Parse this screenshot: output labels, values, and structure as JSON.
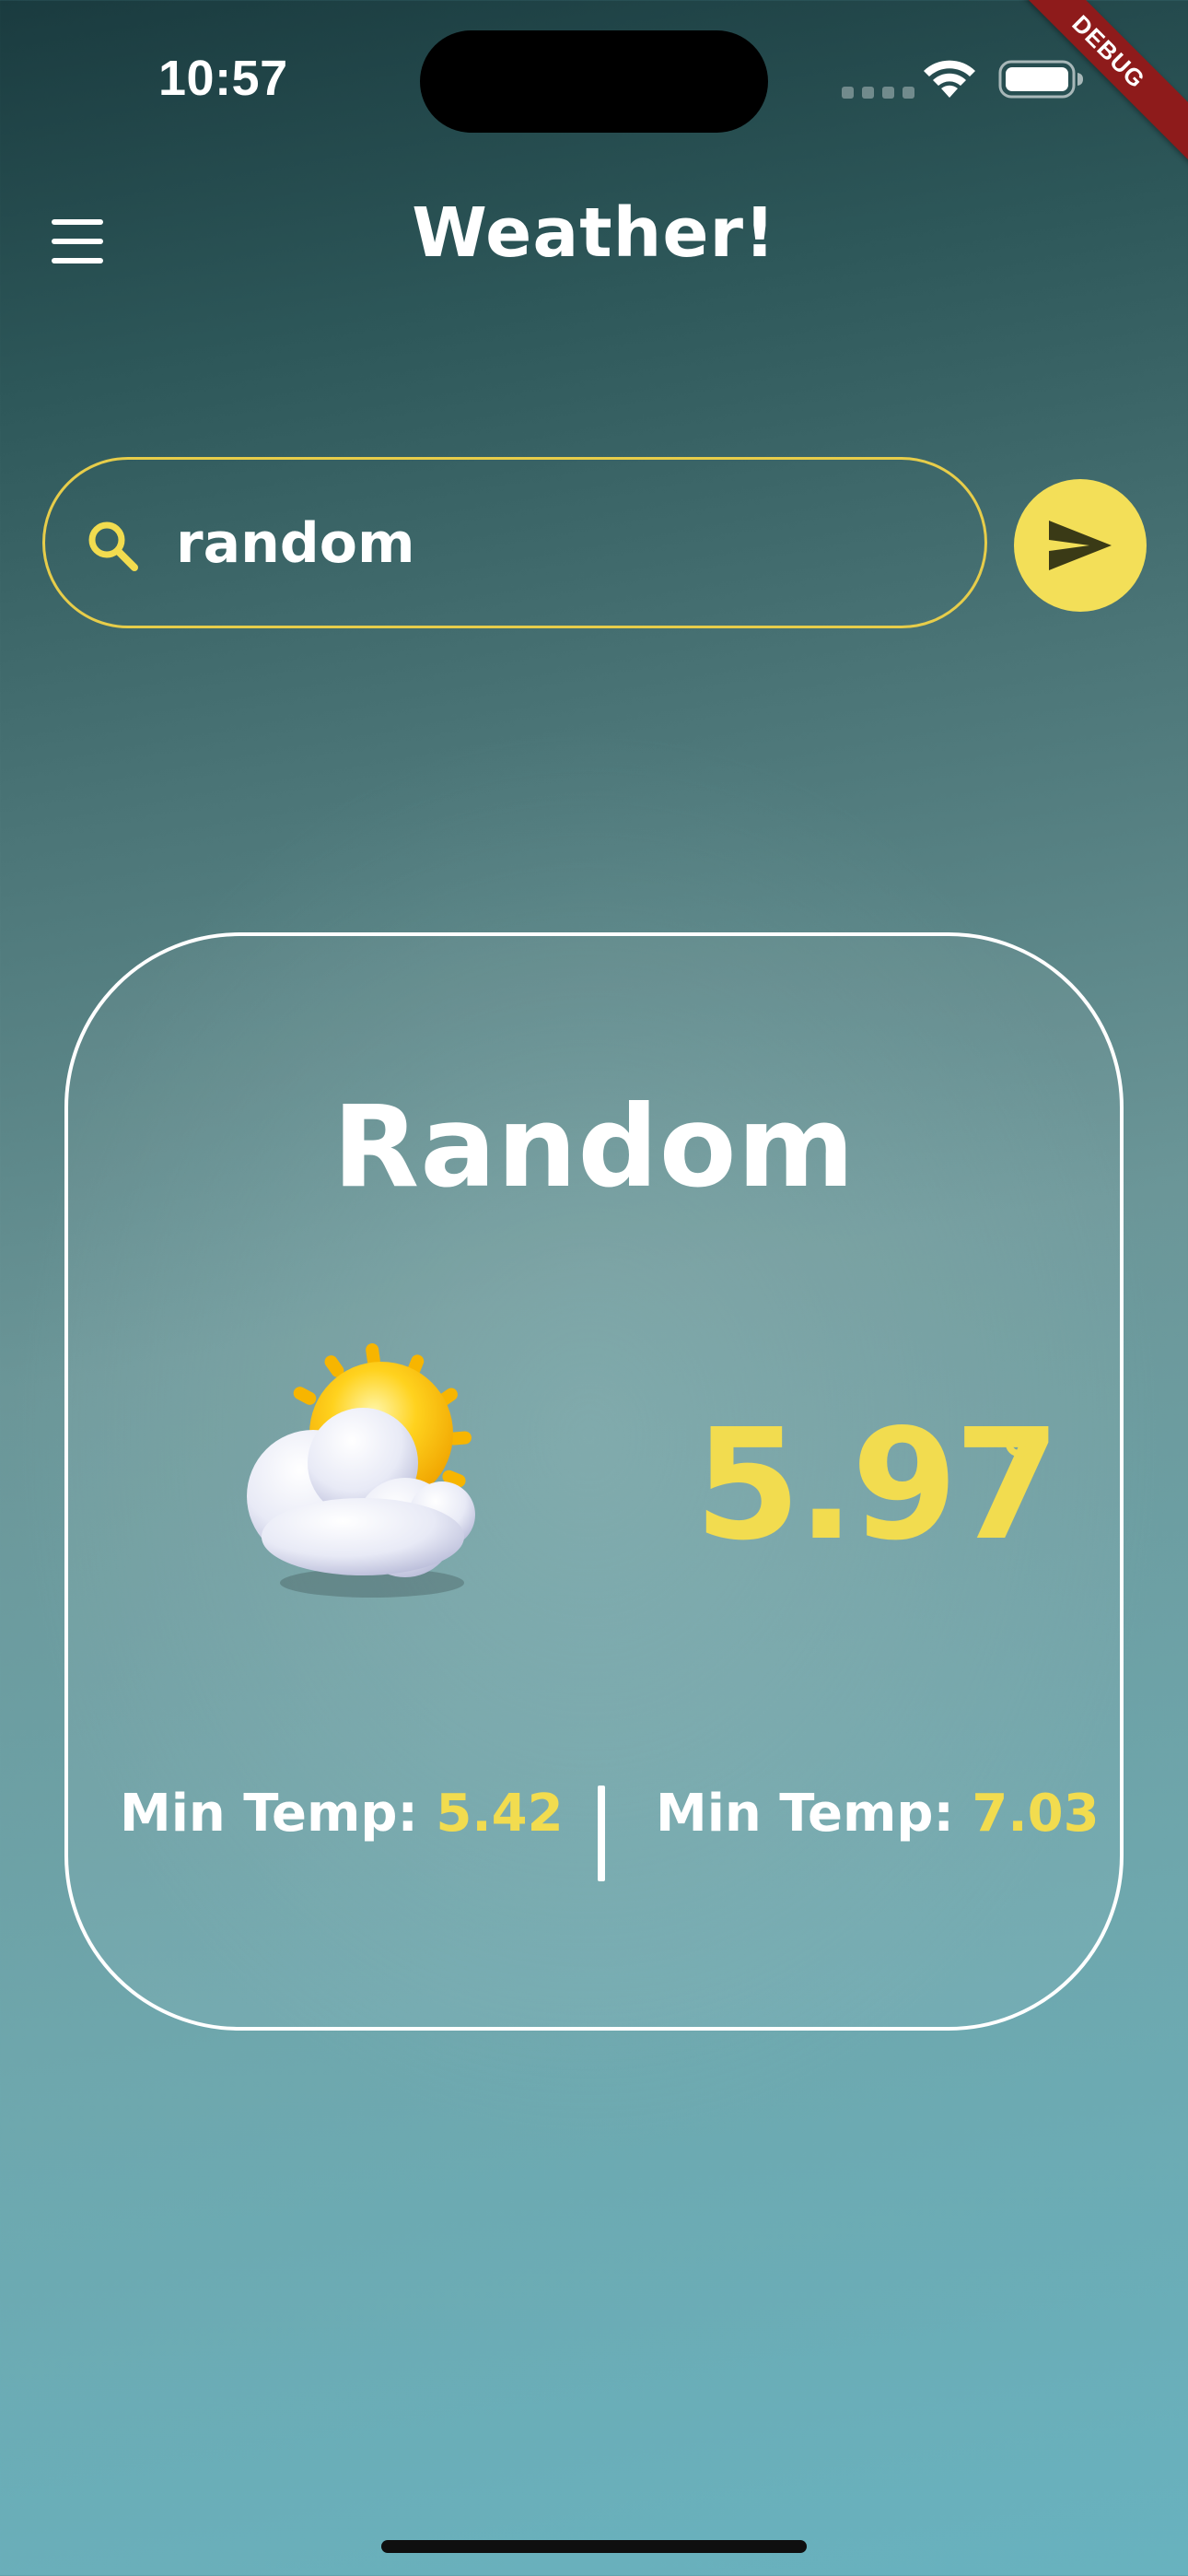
{
  "status_bar": {
    "time": "10:57",
    "icons": [
      "cell-signal-icon",
      "wifi-icon",
      "battery-icon"
    ]
  },
  "debug_banner": "DEBUG",
  "app_bar": {
    "menu_icon": "hamburger-menu-icon",
    "title": "Weather!"
  },
  "search": {
    "icon": "search-icon",
    "value": "random",
    "send_icon": "send-icon"
  },
  "weather": {
    "city": "Random",
    "condition_icon": "sun-behind-cloud-icon",
    "temperature": "5.97",
    "degree_symbol": "°",
    "min_label": "Min Temp: ",
    "min_value": "5.42",
    "max_label": "Min Temp: ",
    "max_value": "7.03"
  },
  "colors": {
    "accent": "#f2dc4f",
    "debug_banner": "#8e1b1b",
    "background_top": "#1a3b3f",
    "background_bottom": "#68b2bf"
  }
}
